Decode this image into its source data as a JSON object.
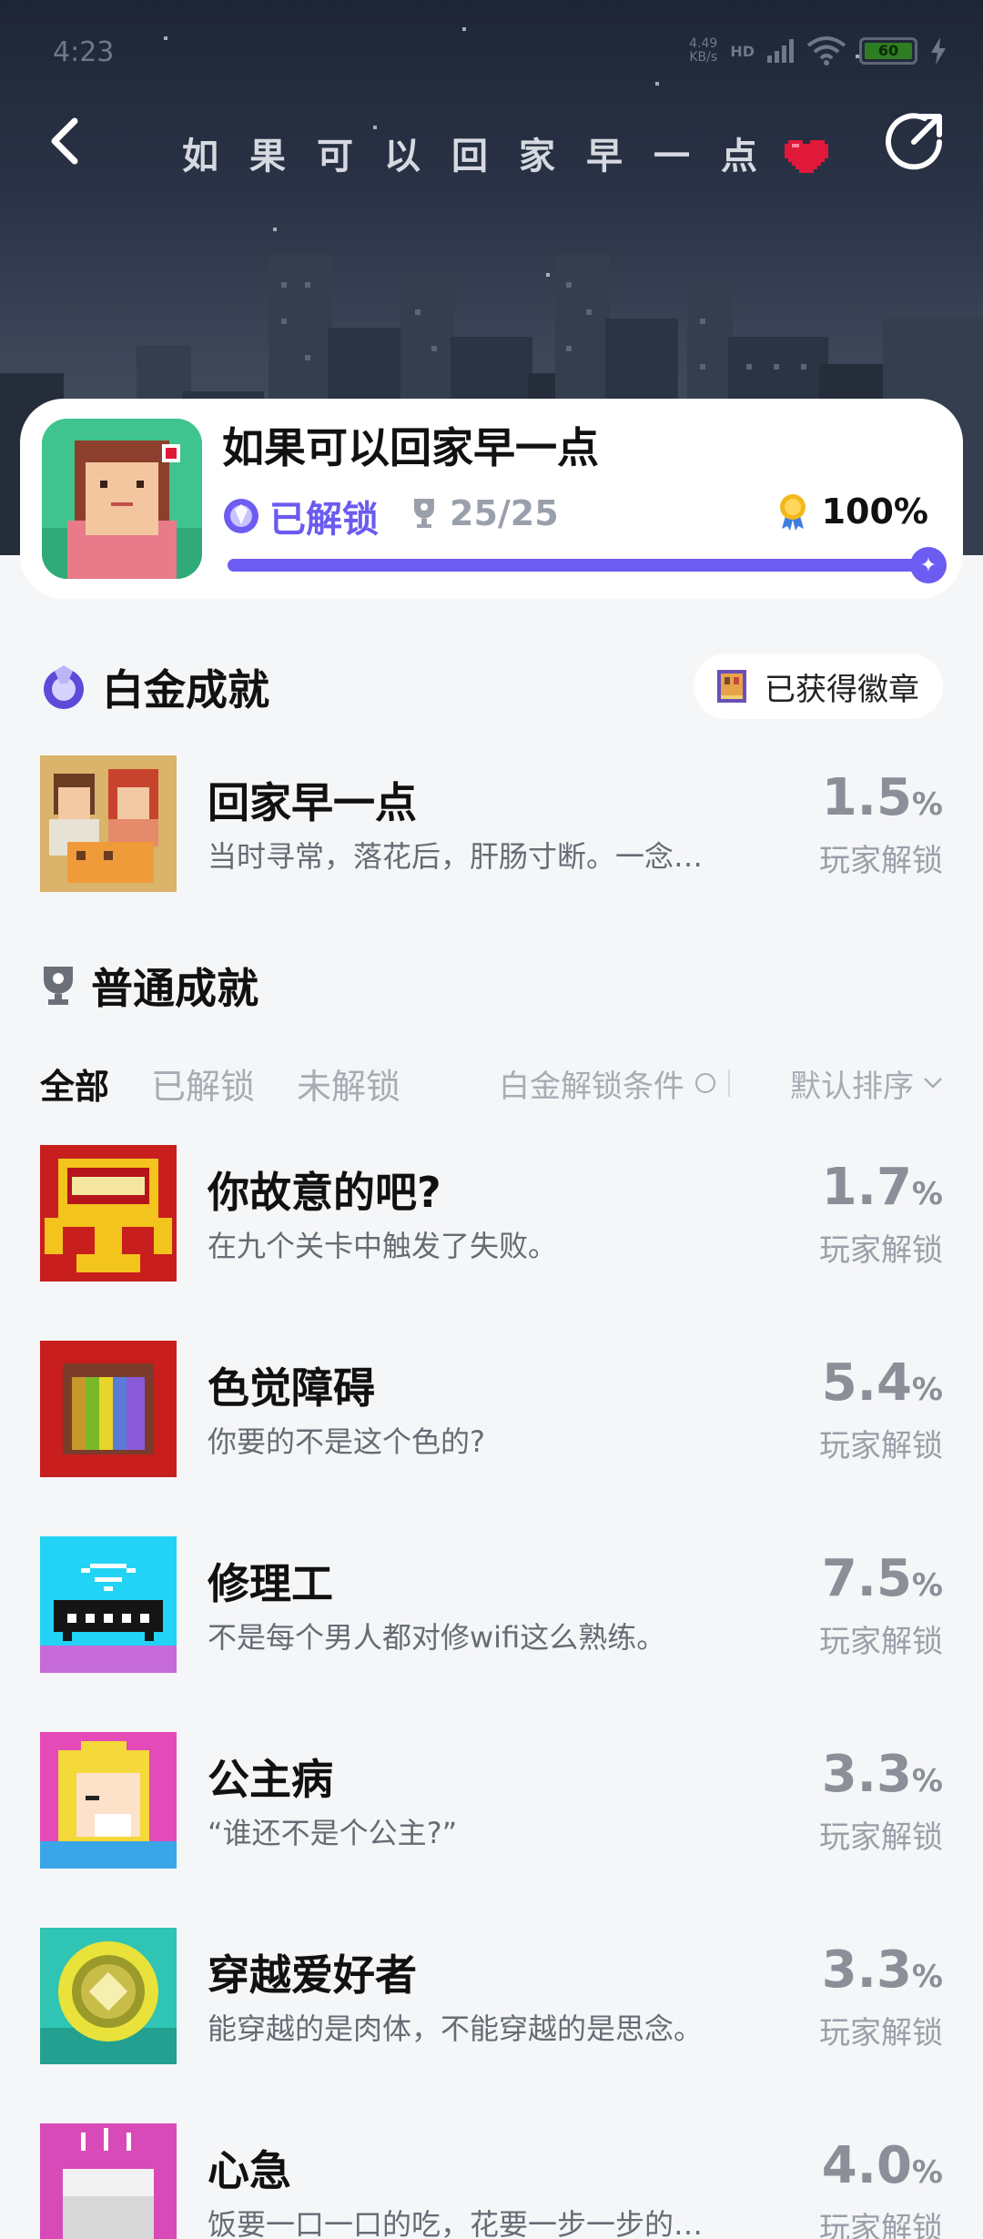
{
  "status_bar": {
    "time": "4:23",
    "network_speed_top": "4.49",
    "network_speed_bottom": "KB/s",
    "network_type": "HD",
    "battery": "60"
  },
  "header": {
    "pixel_title": "如果可以回家早一点"
  },
  "game": {
    "name": "如果可以回家早一点",
    "unlock_status": "已解锁",
    "trophy_count": "25/25",
    "completion": "100%",
    "progress": 1.0
  },
  "platinum_section": {
    "title": "白金成就",
    "badge_button": "已获得徽章",
    "achievement": {
      "name": "回家早一点",
      "desc": "当时寻常，落花后，肝肠寸断。一念…",
      "rate": "1.5",
      "rate_unit": "%",
      "rate_label": "玩家解锁"
    }
  },
  "normal_section": {
    "title": "普通成就",
    "tabs": [
      "全部",
      "已解锁",
      "未解锁"
    ],
    "condition_filter": "白金解锁条件",
    "sort_label": "默认排序",
    "achievements": [
      {
        "name": "你故意的吧?",
        "desc": "在九个关卡中触发了失败。",
        "rate": "1.7",
        "rate_unit": "%",
        "rate_label": "玩家解锁"
      },
      {
        "name": "色觉障碍",
        "desc": "你要的不是这个色的?",
        "rate": "5.4",
        "rate_unit": "%",
        "rate_label": "玩家解锁"
      },
      {
        "name": "修理工",
        "desc": "不是每个男人都对修wifi这么熟练。",
        "rate": "7.5",
        "rate_unit": "%",
        "rate_label": "玩家解锁"
      },
      {
        "name": "公主病",
        "desc": "“谁还不是个公主?”",
        "rate": "3.3",
        "rate_unit": "%",
        "rate_label": "玩家解锁"
      },
      {
        "name": "穿越爱好者",
        "desc": "能穿越的是肉体，不能穿越的是思念。",
        "rate": "3.3",
        "rate_unit": "%",
        "rate_label": "玩家解锁"
      },
      {
        "name": "心急",
        "desc": "饭要一口一口的吃，花要一步一步的…",
        "rate": "4.0",
        "rate_unit": "%",
        "rate_label": "玩家解锁"
      }
    ]
  },
  "colors": {
    "accent": "#6d5cf2",
    "unlock_text": "#6b5bf0",
    "rate_gray": "#8a8f98"
  }
}
